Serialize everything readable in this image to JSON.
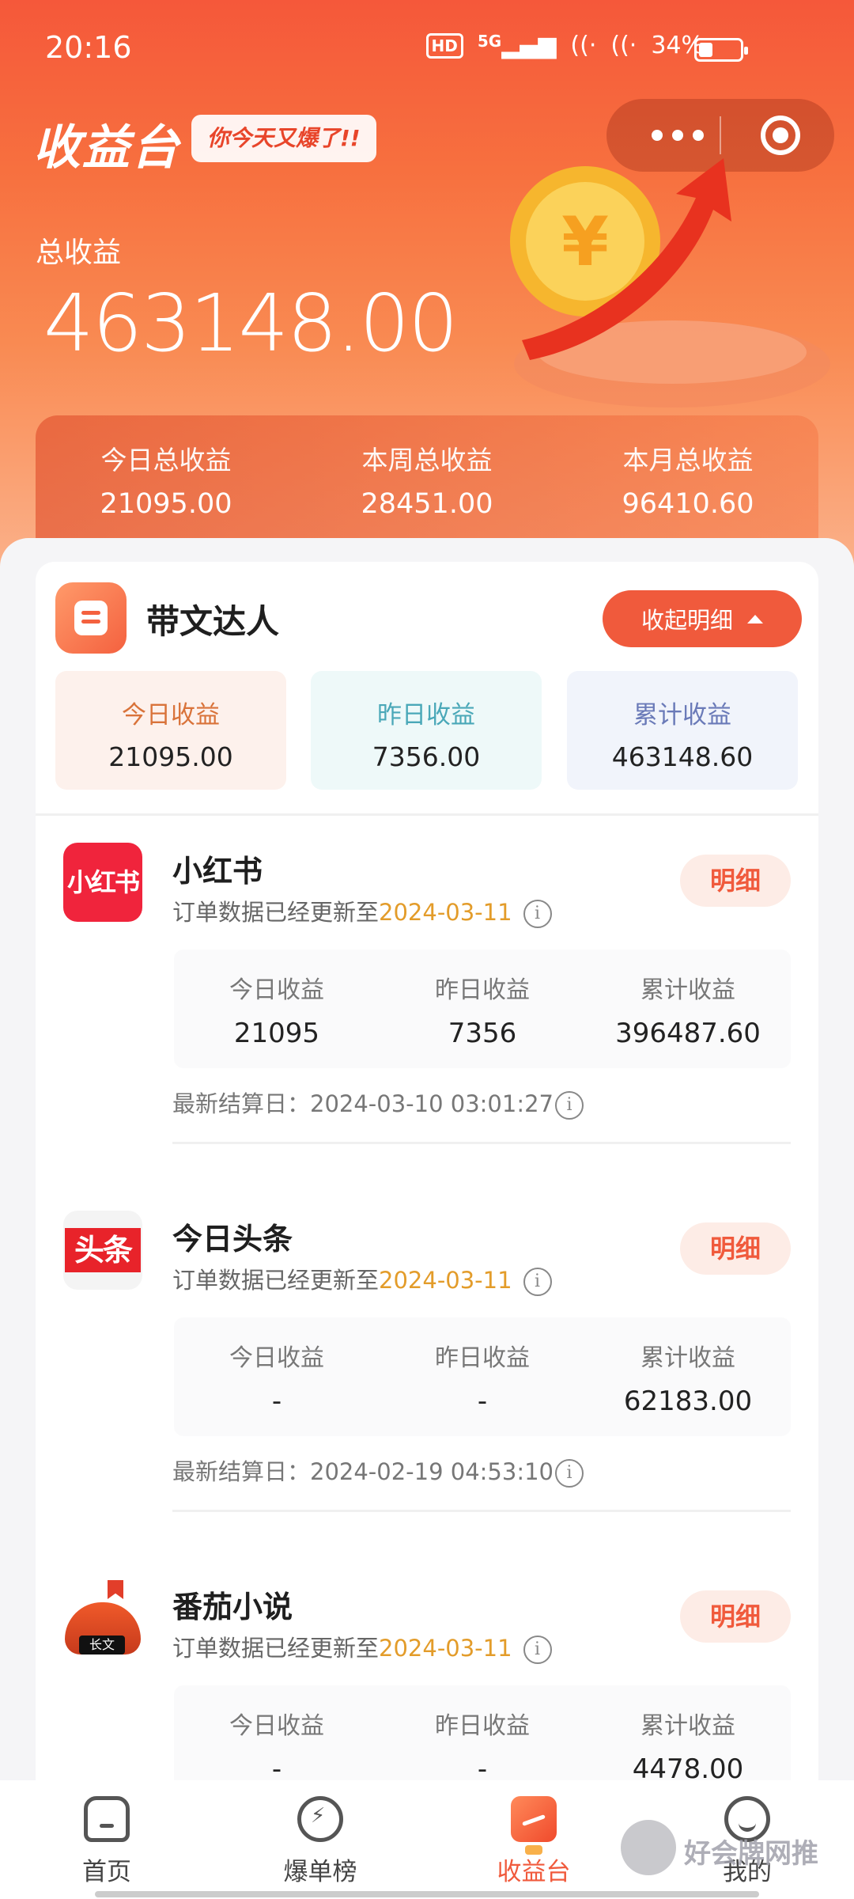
{
  "status_bar": {
    "time": "20:16",
    "hd": "HD",
    "net": "5G",
    "battery": "34%",
    "battery_level": 0.34
  },
  "header": {
    "title": "收益台",
    "slogan": "你今天又爆了!!",
    "total_label": "总收益",
    "total_value": "463148.00"
  },
  "summary": [
    {
      "label": "今日总收益",
      "value": "21095.00"
    },
    {
      "label": "本周总收益",
      "value": "28451.00"
    },
    {
      "label": "本月总收益",
      "value": "96410.60"
    }
  ],
  "daren": {
    "title": "带文达人",
    "collapse_label": "收起明细",
    "stats": [
      {
        "label": "今日收益",
        "value": "21095.00",
        "color": "#d9733a",
        "bg": "#fdf1ec"
      },
      {
        "label": "昨日收益",
        "value": "7356.00",
        "color": "#4aa8b8",
        "bg": "#eef9f9"
      },
      {
        "label": "累计收益",
        "value": "463148.60",
        "color": "#6a7ab8",
        "bg": "#f1f4fb"
      }
    ]
  },
  "platforms": [
    {
      "name": "小红书",
      "logo_text": "小红书",
      "update_prefix": "订单数据已经更新至",
      "update_date": "2024-03-11",
      "detail": "明细",
      "stats": [
        {
          "label": "今日收益",
          "value": "21095"
        },
        {
          "label": "昨日收益",
          "value": "7356"
        },
        {
          "label": "累计收益",
          "value": "396487.60"
        }
      ],
      "settle": "最新结算日：2024-03-10 03:01:27"
    },
    {
      "name": "今日头条",
      "logo_text": "头条",
      "update_prefix": "订单数据已经更新至",
      "update_date": "2024-03-11",
      "detail": "明细",
      "stats": [
        {
          "label": "今日收益",
          "value": "-"
        },
        {
          "label": "昨日收益",
          "value": "-"
        },
        {
          "label": "累计收益",
          "value": "62183.00"
        }
      ],
      "settle": "最新结算日：2024-02-19 04:53:10"
    },
    {
      "name": "番茄小说",
      "logo_text": "长文",
      "update_prefix": "订单数据已经更新至",
      "update_date": "2024-03-11",
      "detail": "明细",
      "stats": [
        {
          "label": "今日收益",
          "value": "-"
        },
        {
          "label": "昨日收益",
          "value": "-"
        },
        {
          "label": "累计收益",
          "value": "4478.00"
        }
      ]
    }
  ],
  "tabs": [
    {
      "label": "首页",
      "icon": "home-icon"
    },
    {
      "label": "爆单榜",
      "icon": "bolt-icon"
    },
    {
      "label": "收益台",
      "icon": "earnings-icon",
      "active": true
    },
    {
      "label": "我的",
      "icon": "profile-icon"
    }
  ],
  "watermark": "好会牌网推"
}
